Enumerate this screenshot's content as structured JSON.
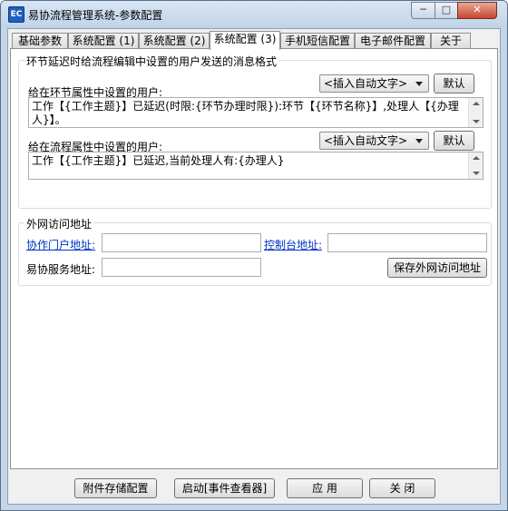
{
  "window": {
    "title": "易协流程管理系统-参数配置",
    "app_icon_text": "EC",
    "min_glyph": "─",
    "max_glyph": "□",
    "close_glyph": "✕"
  },
  "tabs": [
    {
      "label": "基础参数"
    },
    {
      "label": "系统配置 (1)"
    },
    {
      "label": "系统配置 (2)"
    },
    {
      "label": "系统配置 (3)"
    },
    {
      "label": "手机短信配置"
    },
    {
      "label": "电子邮件配置"
    },
    {
      "label": "关于"
    }
  ],
  "active_tab": 3,
  "message_group": {
    "title": "环节延迟时给流程编辑中设置的用户发送的消息格式",
    "node_users_label": "给在环节属性中设置的用户:",
    "insert_combo_label": "<插入自动文字>",
    "default_button": "默认",
    "node_users_text": "工作【{工作主题}】已延迟(时限:{环节办理时限}):环节【{环节名称}】,处理人【{办理人}】。",
    "flow_users_label": "给在流程属性中设置的用户:",
    "flow_users_text": "工作【{工作主题}】已延迟,当前处理人有:{办理人}"
  },
  "external_group": {
    "title": "外网访问地址",
    "portal_label": "协作门户地址:",
    "portal_value": "",
    "console_label": "控制台地址:",
    "console_value": "",
    "service_label": "易协服务地址:",
    "service_value": "",
    "save_button": "保存外网访问地址"
  },
  "bottom_buttons": {
    "attachment": "附件存储配置",
    "event_viewer": "启动[事件查看器]",
    "apply": "应 用",
    "close": "关 闭"
  },
  "colors": {
    "link": "#0033cc",
    "close_button": "#c9452f"
  }
}
